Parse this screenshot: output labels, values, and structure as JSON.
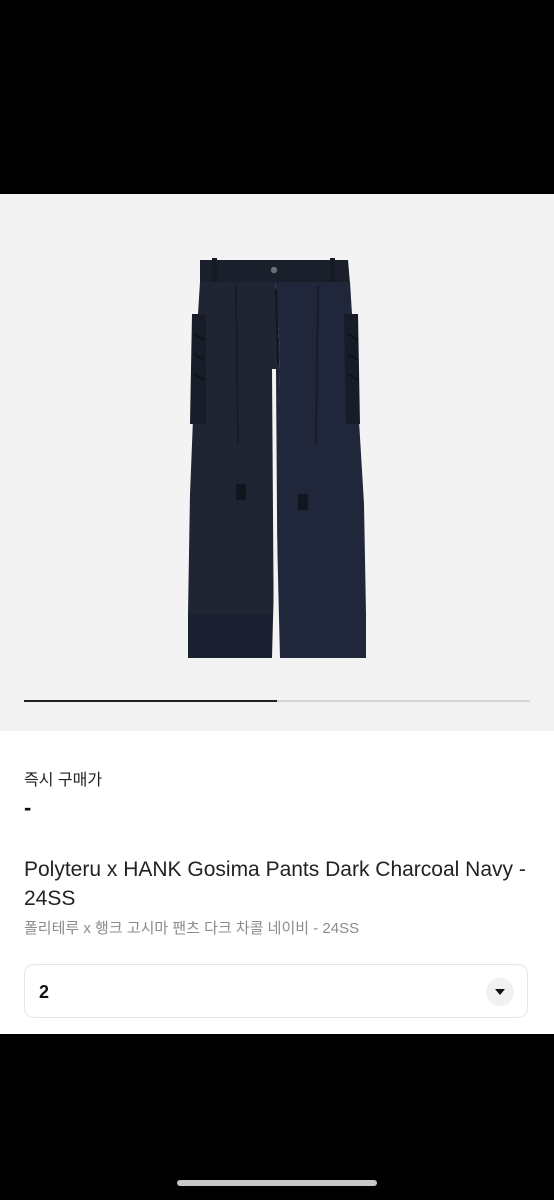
{
  "product": {
    "image": {
      "icon": "navy-wide-cargo-pants-photo",
      "background_color": "#f3f3f3",
      "garment_color": "#1d2230"
    },
    "gallery_progress": 0.5,
    "instant_price_label": "즉시 구매가",
    "instant_price_value": "-",
    "title_en": "Polyteru x HANK Gosima Pants Dark Charcoal Navy - 24SS",
    "title_ko": "폴리테루 x 행크 고시마 팬츠 다크 차콜 네이비 - 24SS"
  },
  "size_selector": {
    "value": "2",
    "icon": "chevron-down-icon"
  },
  "colors": {
    "accent_text": "#222222",
    "muted_text": "#8b8b8b"
  }
}
